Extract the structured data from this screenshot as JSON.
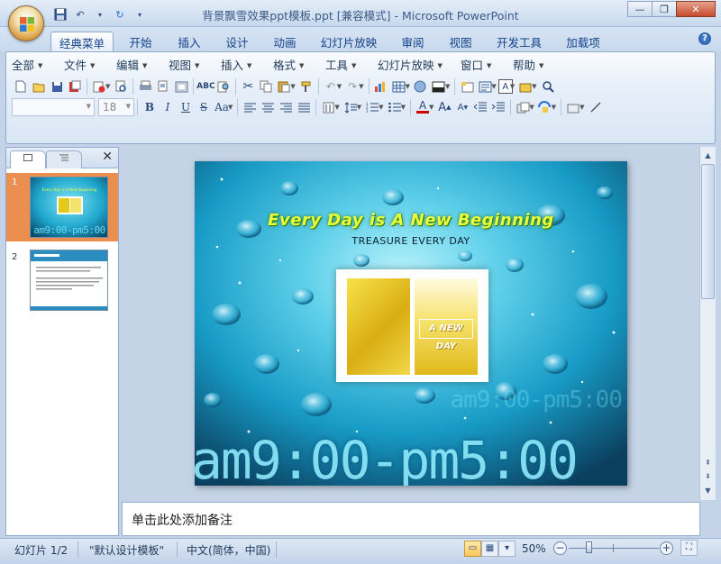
{
  "window": {
    "title": "背景飘雪效果ppt模板.ppt [兼容模式] - Microsoft PowerPoint",
    "minimize_icon": "minimize-icon",
    "maximize_icon": "restore-icon",
    "close_icon": "close-icon"
  },
  "quick_access": [
    "save-icon",
    "undo-icon",
    "redo-icon",
    "customize-dropdown-icon"
  ],
  "ribbon_tabs": [
    {
      "label": "经典菜单",
      "active": true
    },
    {
      "label": "开始"
    },
    {
      "label": "插入"
    },
    {
      "label": "设计"
    },
    {
      "label": "动画"
    },
    {
      "label": "幻灯片放映"
    },
    {
      "label": "审阅"
    },
    {
      "label": "视图"
    },
    {
      "label": "开发工具"
    },
    {
      "label": "加载项"
    }
  ],
  "classic_menu": [
    "全部",
    "文件",
    "编辑",
    "视图",
    "插入",
    "格式",
    "工具",
    "幻灯片放映",
    "窗口",
    "帮助"
  ],
  "toolbar": {
    "font_name_value": "",
    "font_size_value": "18",
    "bold": "B",
    "italic": "I",
    "underline": "U",
    "strike": "S",
    "case": "Aa"
  },
  "slides_panel": {
    "slides": [
      {
        "number": "1",
        "selected": true
      },
      {
        "number": "2",
        "selected": false
      }
    ]
  },
  "slide": {
    "title": "Every Day is A New Beginning",
    "subtitle": "TREASURE EVERY DAY",
    "window_label": "A NEW DAY",
    "clock_text": "am9:00-pm5:00",
    "clock_echo": "am9:00-pm5:00"
  },
  "notes": {
    "placeholder": "单击此处添加备注"
  },
  "status": {
    "slide_counter": "幻灯片 1/2",
    "theme": "\"默认设计模板\"",
    "language": "中文(简体，中国)",
    "zoom": "50%",
    "zoom_level": 0.5
  },
  "colors": {
    "accent": "#1f8fb7",
    "title_text": "#e8ff3a",
    "ribbon_bg": "#dbe7f5"
  }
}
